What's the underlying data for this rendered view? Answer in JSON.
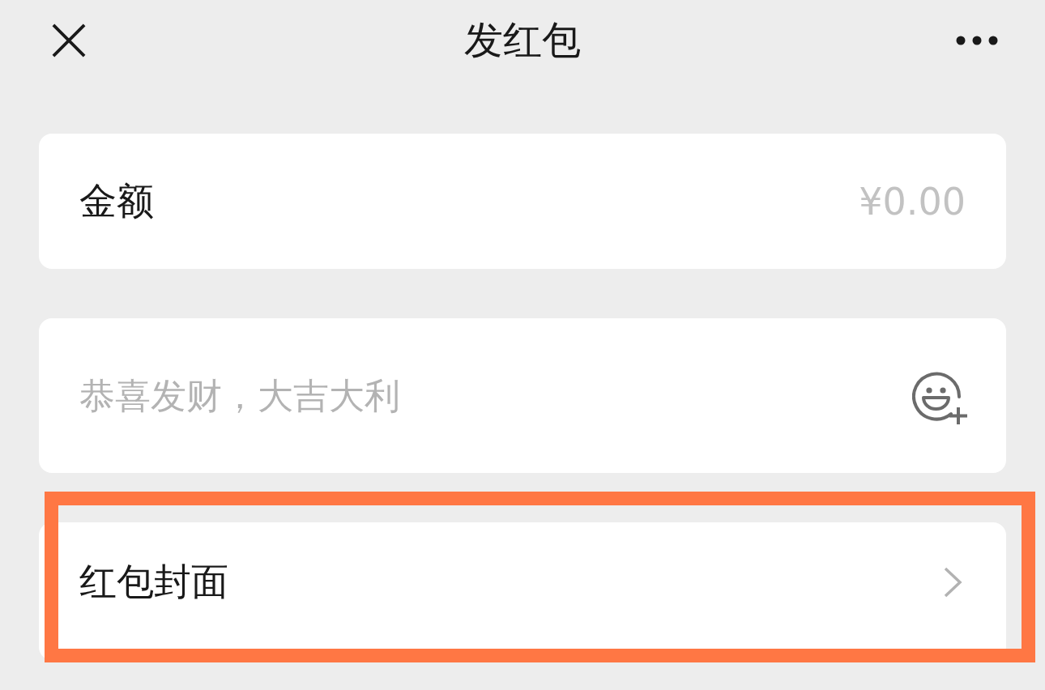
{
  "header": {
    "title": "发红包"
  },
  "amount": {
    "label": "金额",
    "placeholder": "¥0.00"
  },
  "message": {
    "placeholder": "恭喜发财，大吉大利"
  },
  "cover": {
    "label": "红包封面",
    "highlighted": true
  }
}
